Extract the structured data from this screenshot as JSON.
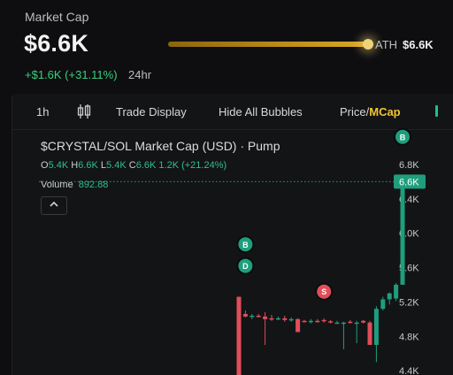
{
  "market_cap": {
    "label": "Market Cap",
    "value": "$6.6K",
    "ath_label": "ATH",
    "ath_value": "$6.6K",
    "ath_progress": 0.98,
    "change": "+$1.6K (+31.11%)",
    "change_period": "24hr"
  },
  "toolbar": {
    "interval": "1h",
    "candle_icon": "candlestick-icon",
    "trade_display": "Trade Display",
    "hide_bubbles": "Hide All Bubbles",
    "price_label": "Price/",
    "mcap_label": "MCap"
  },
  "chart_header": {
    "title": "$CRYSTAL/SOL Market Cap (USD) · Pump",
    "o_label": "O",
    "o_value": "5.4K",
    "h_label": "H",
    "h_value": "6.6K",
    "l_label": "L",
    "l_value": "5.4K",
    "c_label": "C",
    "c_value": "6.6K",
    "change": "1.2K (+21.24%)",
    "volume_label": "Volume",
    "volume_value": "892.88",
    "collapse_icon": "chevron-up-icon"
  },
  "colors": {
    "up": "#1f9e7d",
    "down": "#e04e5a",
    "gold": "#d9a822",
    "accent": "#f2c431"
  },
  "chart_data": {
    "type": "candlestick",
    "title": "$CRYSTAL/SOL Market Cap (USD) · Pump",
    "y_ticks": [
      "6.8K",
      "6.4K",
      "6.0K",
      "5.6K",
      "5.2K",
      "4.8K",
      "4.4K"
    ],
    "y_tick_values": [
      6800,
      6400,
      6000,
      5600,
      5200,
      4800,
      4400
    ],
    "ylim": [
      4350,
      7200
    ],
    "last_price_label": "6.6K",
    "last_price": 6600,
    "candles": [
      {
        "o": 5260,
        "h": 5260,
        "l": 4350,
        "c": 4350
      },
      {
        "o": 5060,
        "h": 5100,
        "l": 5020,
        "c": 5030
      },
      {
        "o": 5030,
        "h": 5060,
        "l": 5000,
        "c": 5040
      },
      {
        "o": 5040,
        "h": 5060,
        "l": 5020,
        "c": 5030
      },
      {
        "o": 5030,
        "h": 5080,
        "l": 4700,
        "c": 5000
      },
      {
        "o": 5010,
        "h": 5050,
        "l": 4980,
        "c": 5000
      },
      {
        "o": 5000,
        "h": 5030,
        "l": 4990,
        "c": 5010
      },
      {
        "o": 5010,
        "h": 5040,
        "l": 4970,
        "c": 4990
      },
      {
        "o": 4990,
        "h": 5020,
        "l": 4970,
        "c": 5000
      },
      {
        "o": 5000,
        "h": 5010,
        "l": 4850,
        "c": 4850
      },
      {
        "o": 4980,
        "h": 4990,
        "l": 4960,
        "c": 4970
      },
      {
        "o": 4970,
        "h": 5000,
        "l": 4950,
        "c": 4980
      },
      {
        "o": 4980,
        "h": 5000,
        "l": 4960,
        "c": 4970
      },
      {
        "o": 4990,
        "h": 5010,
        "l": 4960,
        "c": 4975
      },
      {
        "o": 4975,
        "h": 4990,
        "l": 4950,
        "c": 4965
      },
      {
        "o": 4960,
        "h": 4980,
        "l": 4950,
        "c": 4960
      },
      {
        "o": 4960,
        "h": 4970,
        "l": 4650,
        "c": 4960
      },
      {
        "o": 4970,
        "h": 4990,
        "l": 4950,
        "c": 4960
      },
      {
        "o": 4960,
        "h": 4980,
        "l": 4720,
        "c": 4960
      },
      {
        "o": 4980,
        "h": 4990,
        "l": 4950,
        "c": 4960
      },
      {
        "o": 4960,
        "h": 4980,
        "l": 4700,
        "c": 4700
      },
      {
        "o": 4700,
        "h": 5150,
        "l": 4500,
        "c": 5120
      },
      {
        "o": 5120,
        "h": 5260,
        "l": 5100,
        "c": 5230
      },
      {
        "o": 5230,
        "h": 5310,
        "l": 5170,
        "c": 5300
      },
      {
        "o": 5240,
        "h": 5420,
        "l": 5210,
        "c": 5400
      },
      {
        "o": 5400,
        "h": 6660,
        "l": 5400,
        "c": 6600
      }
    ],
    "bubbles": [
      {
        "label": "B",
        "type": "buy",
        "candle": 25,
        "value": 7120
      },
      {
        "label": "B",
        "type": "buy",
        "candle": 1,
        "value": 5870
      },
      {
        "label": "D",
        "type": "dev",
        "candle": 1,
        "value": 5620
      },
      {
        "label": "S",
        "type": "sell",
        "candle": 13,
        "value": 5320
      }
    ]
  }
}
